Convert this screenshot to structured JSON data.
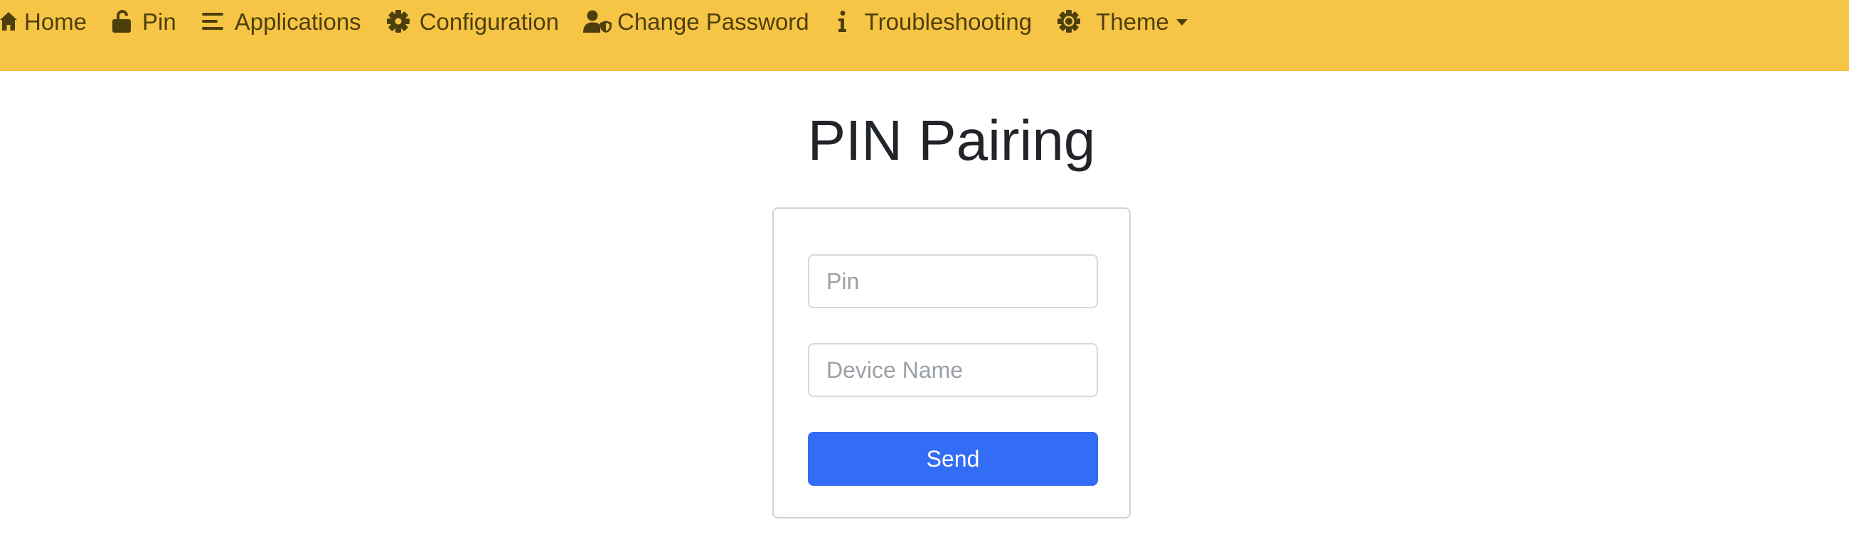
{
  "nav": {
    "items": [
      {
        "label": "Home",
        "icon": "home-icon"
      },
      {
        "label": "Pin",
        "icon": "unlock-icon"
      },
      {
        "label": "Applications",
        "icon": "list-icon"
      },
      {
        "label": "Configuration",
        "icon": "gear-icon"
      },
      {
        "label": "Change Password",
        "icon": "user-shield-icon"
      },
      {
        "label": "Troubleshooting",
        "icon": "info-icon"
      },
      {
        "label": "Theme",
        "icon": "theme-gear-icon"
      }
    ],
    "background_color": "#f7c545",
    "text_color": "#4d3f0d"
  },
  "main": {
    "title": "PIN Pairing",
    "form": {
      "pin_placeholder": "Pin",
      "pin_value": "",
      "device_placeholder": "Device Name",
      "device_value": "",
      "send_label": "Send",
      "send_color": "#336cf5"
    }
  }
}
